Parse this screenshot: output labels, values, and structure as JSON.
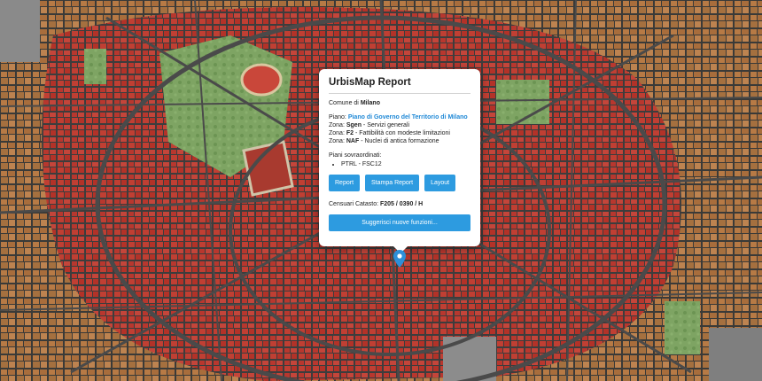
{
  "popup": {
    "title": "UrbisMap Report",
    "comune_label": "Comune di",
    "comune_value": "Milano",
    "piano_label": "Piano:",
    "piano_value": "Piano di Governo del Territorio di Milano",
    "zones": [
      {
        "label": "Zona:",
        "code": "Sgen",
        "desc": " - Servizi generali"
      },
      {
        "label": "Zona:",
        "code": "F2",
        "desc": " - Fattibilità con modeste limitazioni"
      },
      {
        "label": "Zona:",
        "code": "NAF",
        "desc": " - Nuclei di antica formazione"
      }
    ],
    "piani_label": "Piani sovraordinati:",
    "piani_items": [
      "PTRL - FSC12"
    ],
    "buttons": {
      "report": "Report",
      "stampa": "Stampa Report",
      "layout": "Layout"
    },
    "censuari_label": "Censuari Catasto:",
    "censuari_value": "F205 / 0390 / H",
    "suggest_label": "Suggerisci nuove funzioni..."
  },
  "colors": {
    "accent": "#2d9be0",
    "link": "#1e88d6",
    "overlay_red": "#c0392b",
    "park_green": "#6f9a56",
    "road": "#4a4a4a"
  },
  "icons": {
    "marker": "map-pin-icon"
  }
}
